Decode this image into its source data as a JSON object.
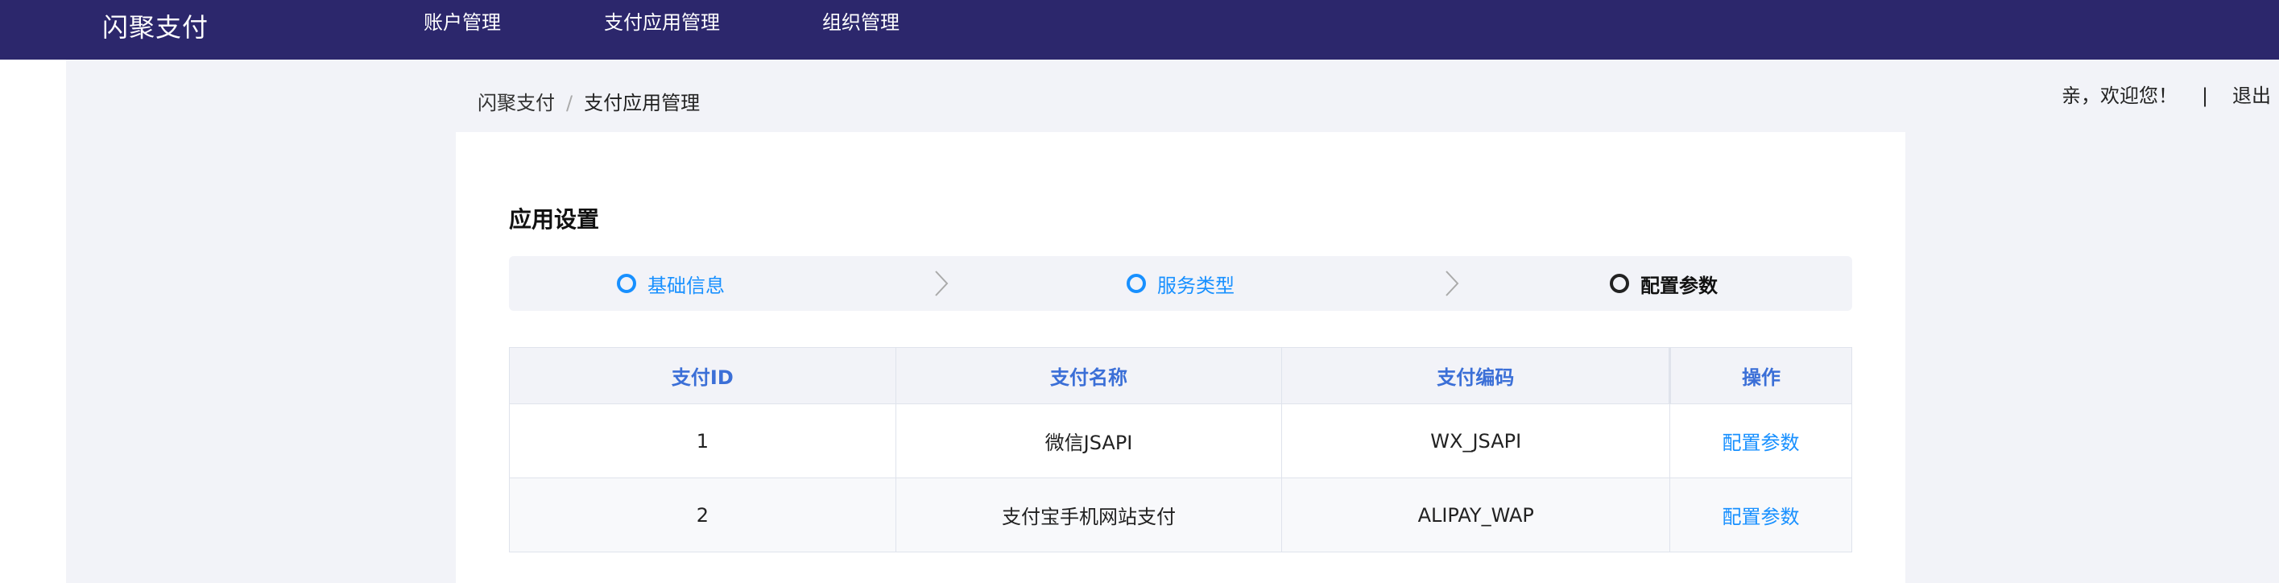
{
  "header": {
    "brand": "闪聚支付",
    "nav": [
      "账户管理",
      "支付应用管理",
      "组织管理"
    ]
  },
  "user": {
    "greeting": "亲，欢迎您！",
    "separator": "|",
    "logout": "退出"
  },
  "breadcrumb": {
    "home": "闪聚支付",
    "separator": "/",
    "current": "支付应用管理"
  },
  "card": {
    "title": "应用设置"
  },
  "steps": [
    {
      "label": "基础信息",
      "state": "done"
    },
    {
      "label": "服务类型",
      "state": "done"
    },
    {
      "label": "配置参数",
      "state": "active"
    }
  ],
  "table": {
    "headers": [
      "支付ID",
      "支付名称",
      "支付编码",
      "操作"
    ],
    "rows": [
      {
        "id": "1",
        "name": "微信JSAPI",
        "code": "WX_JSAPI",
        "action": "配置参数"
      },
      {
        "id": "2",
        "name": "支付宝手机网站支付",
        "code": "ALIPAY_WAP",
        "action": "配置参数"
      }
    ]
  },
  "colors": {
    "header_bg": "#2c276c",
    "accent": "#1890ff",
    "table_header_text": "#3b6fd7",
    "page_bg": "#f2f3f8"
  }
}
